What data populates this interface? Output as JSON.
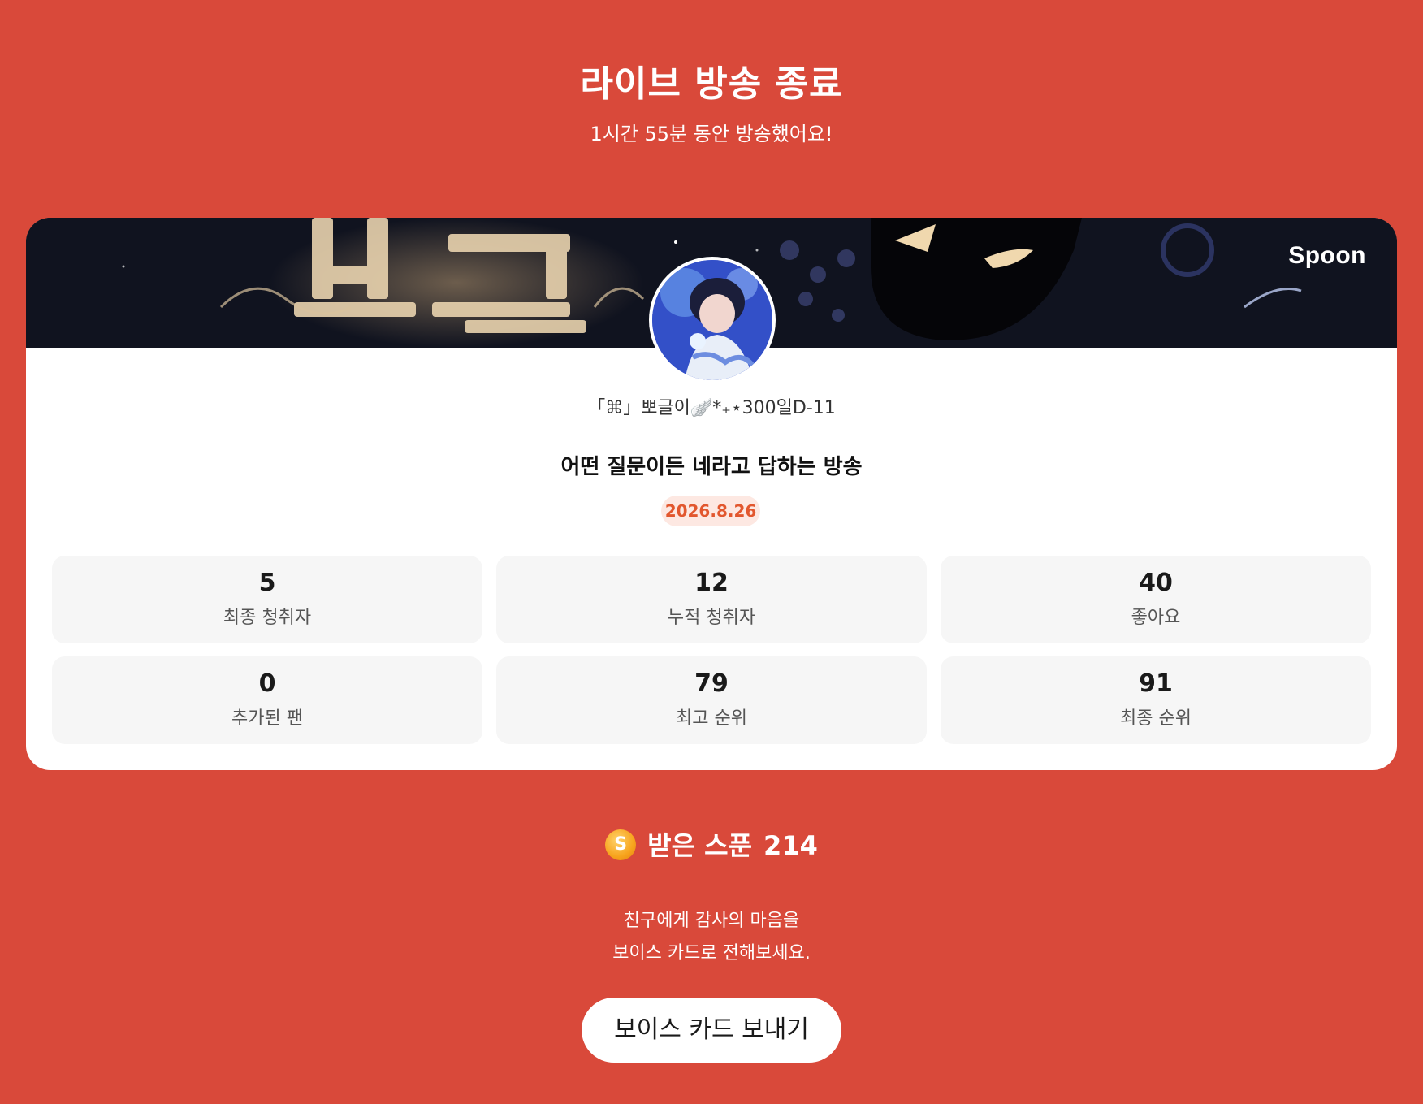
{
  "header": {
    "title": "라이브 방송 종료",
    "subtitle": "1시간 55분 동안 방송했어요!"
  },
  "card": {
    "brand": "Spoon",
    "nickname": "「⌘」뽀글이🪽*₊⋆300일D-11",
    "broadcast_title": "어떤 질문이든 네라고 답하는 방송",
    "date": "2026.8.26",
    "stats": [
      {
        "value": "5",
        "label": "최종 청취자"
      },
      {
        "value": "12",
        "label": "누적 청취자"
      },
      {
        "value": "40",
        "label": "좋아요"
      },
      {
        "value": "0",
        "label": "추가된 팬"
      },
      {
        "value": "79",
        "label": "최고 순위"
      },
      {
        "value": "91",
        "label": "최종 순위"
      }
    ]
  },
  "spoons": {
    "coin_symbol": "S",
    "label": "받은 스푼",
    "count": "214"
  },
  "thanks": {
    "line1": "친구에게 감사의 마음을",
    "line2": "보이스 카드로 전해보세요."
  },
  "voice_card_button": "보이스 카드 보내기",
  "colors": {
    "background": "#d9493a",
    "card": "#ffffff",
    "date_badge_bg": "#fde8e2",
    "date_badge_text": "#e2572e",
    "coin": "#f7a31c"
  }
}
